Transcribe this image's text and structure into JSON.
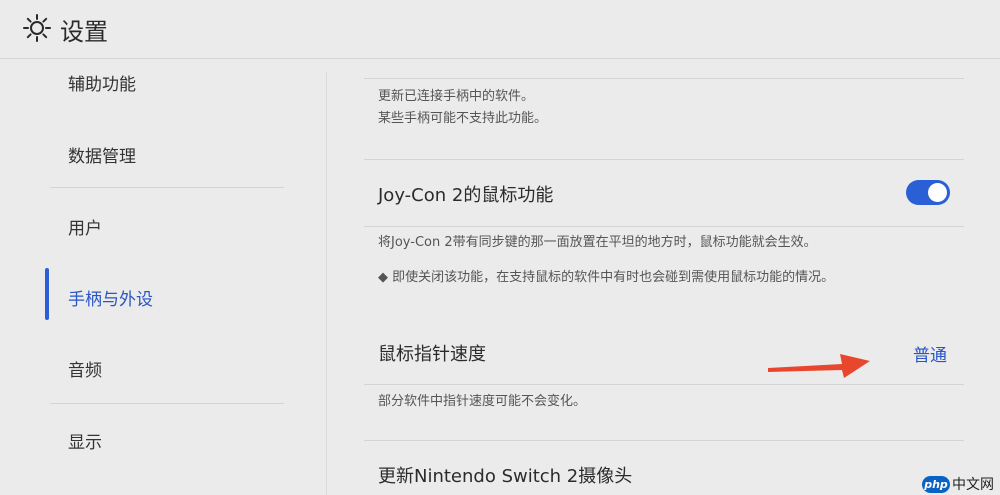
{
  "header": {
    "title": "设置",
    "icon": "gear-icon"
  },
  "sidebar": {
    "items": [
      {
        "label": "辅助功能"
      },
      {
        "label": "数据管理"
      },
      {
        "label": "用户"
      },
      {
        "label": "手柄与外设"
      },
      {
        "label": "音频"
      },
      {
        "label": "显示"
      }
    ],
    "active": "手柄与外设"
  },
  "content": {
    "update_desc_1": "更新已连接手柄中的软件。",
    "update_desc_2": "某些手柄可能不支持此功能。",
    "mouse_label": "Joy-Con 2的鼠标功能",
    "mouse_toggle_on": true,
    "mouse_desc_1": "将Joy-Con 2带有同步键的那一面放置在平坦的地方时，鼠标功能就会生效。",
    "mouse_desc_2": "◆ 即使关闭该功能，在支持鼠标的软件中有时也会碰到需使用鼠标功能的情况。",
    "speed_label": "鼠标指针速度",
    "speed_value": "普通",
    "speed_desc": "部分软件中指针速度可能不会变化。",
    "camera_label": "更新Nintendo Switch 2摄像头"
  },
  "watermark": {
    "badge": "php",
    "text": "中文网"
  },
  "colors": {
    "accent": "#2a5fd6",
    "arrow": "#e8472e",
    "background": "#ebebeb"
  }
}
